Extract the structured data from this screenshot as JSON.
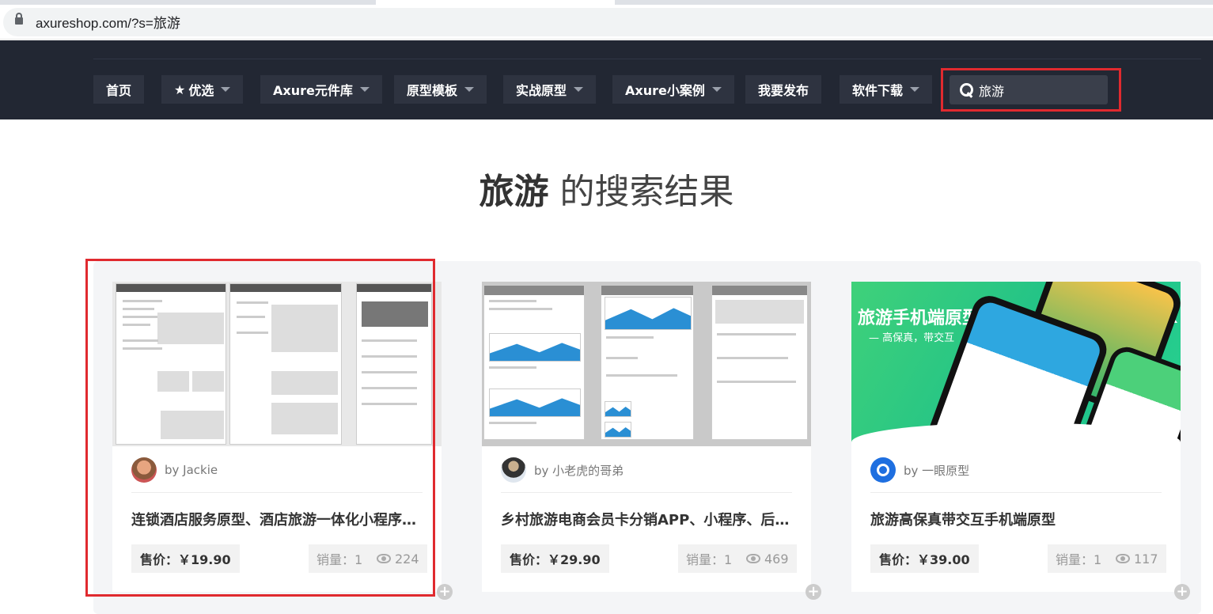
{
  "browser": {
    "url": "axureshop.com/?s=旅游"
  },
  "nav": {
    "items": [
      {
        "label": "首页",
        "dropdown": false
      },
      {
        "label": "优选",
        "dropdown": true,
        "icon": "star-icon"
      },
      {
        "label": "Axure元件库",
        "dropdown": true
      },
      {
        "label": "原型模板",
        "dropdown": true
      },
      {
        "label": "实战原型",
        "dropdown": true
      },
      {
        "label": "Axure小案例",
        "dropdown": true
      },
      {
        "label": "我要发布",
        "dropdown": false
      },
      {
        "label": "软件下载",
        "dropdown": true
      }
    ],
    "search_value": "旅游"
  },
  "results": {
    "keyword": "旅游",
    "suffix": " 的搜索结果"
  },
  "cards": [
    {
      "author": "by Jackie",
      "title": "连锁酒店服务原型、酒店旅游一体化小程序原型",
      "price": "售价：￥19.90",
      "sales": "销量：1",
      "views": "224"
    },
    {
      "author": "by 小老虎的哥弟",
      "title": "乡村旅游电商会员卡分销APP、小程序、后台原型",
      "price": "售价：￥29.90",
      "sales": "销量：1",
      "views": "469"
    },
    {
      "author": "by 一眼原型",
      "title": "旅游高保真带交互手机端原型",
      "price": "售价：￥39.00",
      "sales": "销量：1",
      "views": "117"
    }
  ],
  "thumb3": {
    "title": "旅游手机端原型",
    "subtitle": "— 高保真，带交互"
  },
  "colors": {
    "header_bg": "#222733",
    "highlight": "#e02a2f",
    "accent_green": "#1cc08a"
  }
}
